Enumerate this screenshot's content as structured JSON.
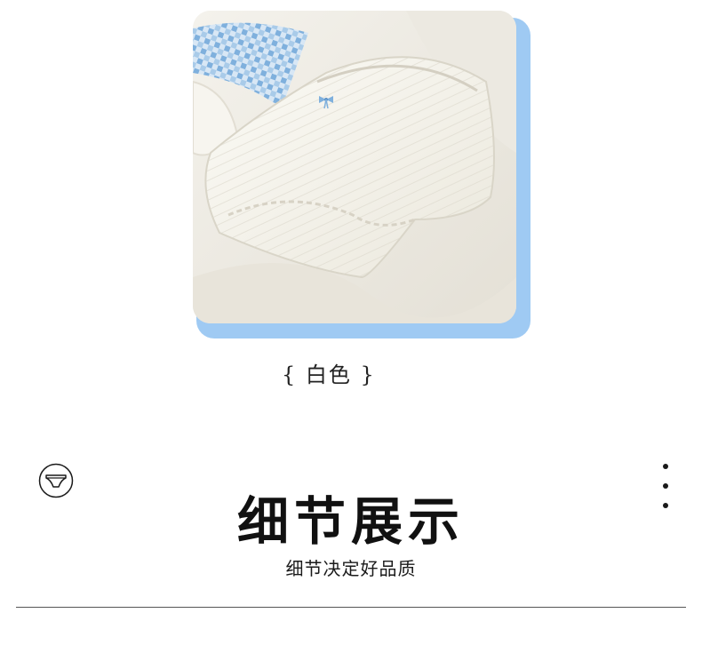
{
  "product": {
    "image_alt": "white ribbed cotton briefs with blue bow",
    "color_label": "{ 白色 }"
  },
  "section": {
    "title": "细节展示",
    "subtitle": "细节决定好品质"
  },
  "icons": {
    "left": "underwear-icon",
    "right": "more-vertical-icon"
  },
  "colors": {
    "card_accent": "#9fcaf3",
    "text": "#1a1a1a"
  }
}
